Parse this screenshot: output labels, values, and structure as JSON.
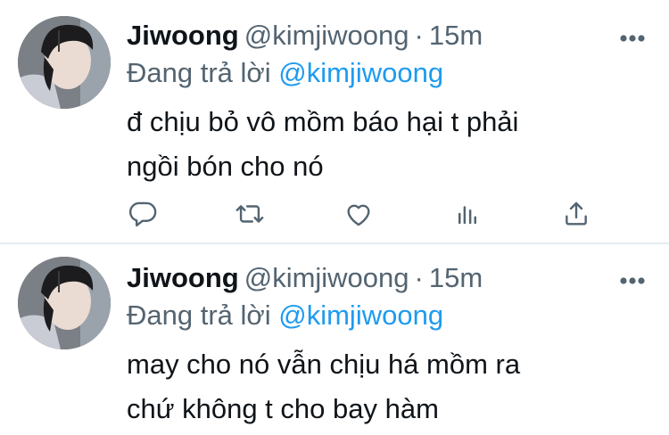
{
  "tweets": [
    {
      "display_name": "Jiwoong",
      "handle": "@kimjiwoong",
      "separator": "·",
      "time": "15m",
      "reply_prefix": "Đang trả lời",
      "reply_to": "@kimjiwoong",
      "text_line_1": "đ chịu bỏ vô mồm báo hại t phải",
      "text_line_2": "ngồi bón cho nó"
    },
    {
      "display_name": "Jiwoong",
      "handle": "@kimjiwoong",
      "separator": "·",
      "time": "15m",
      "reply_prefix": "Đang trả lời",
      "reply_to": "@kimjiwoong",
      "text_line_1": "may cho nó vẫn chịu há mồm ra",
      "text_line_2": "chứ không t cho bay hàm"
    }
  ],
  "icons": {
    "more": "more-horizontal-icon",
    "reply": "reply-icon",
    "retweet": "retweet-icon",
    "like": "heart-icon",
    "analytics": "analytics-icon",
    "share": "share-icon"
  },
  "colors": {
    "text": "#0f1419",
    "secondary": "#536471",
    "accent": "#1d9bf0",
    "divider": "#e6ecf0"
  }
}
